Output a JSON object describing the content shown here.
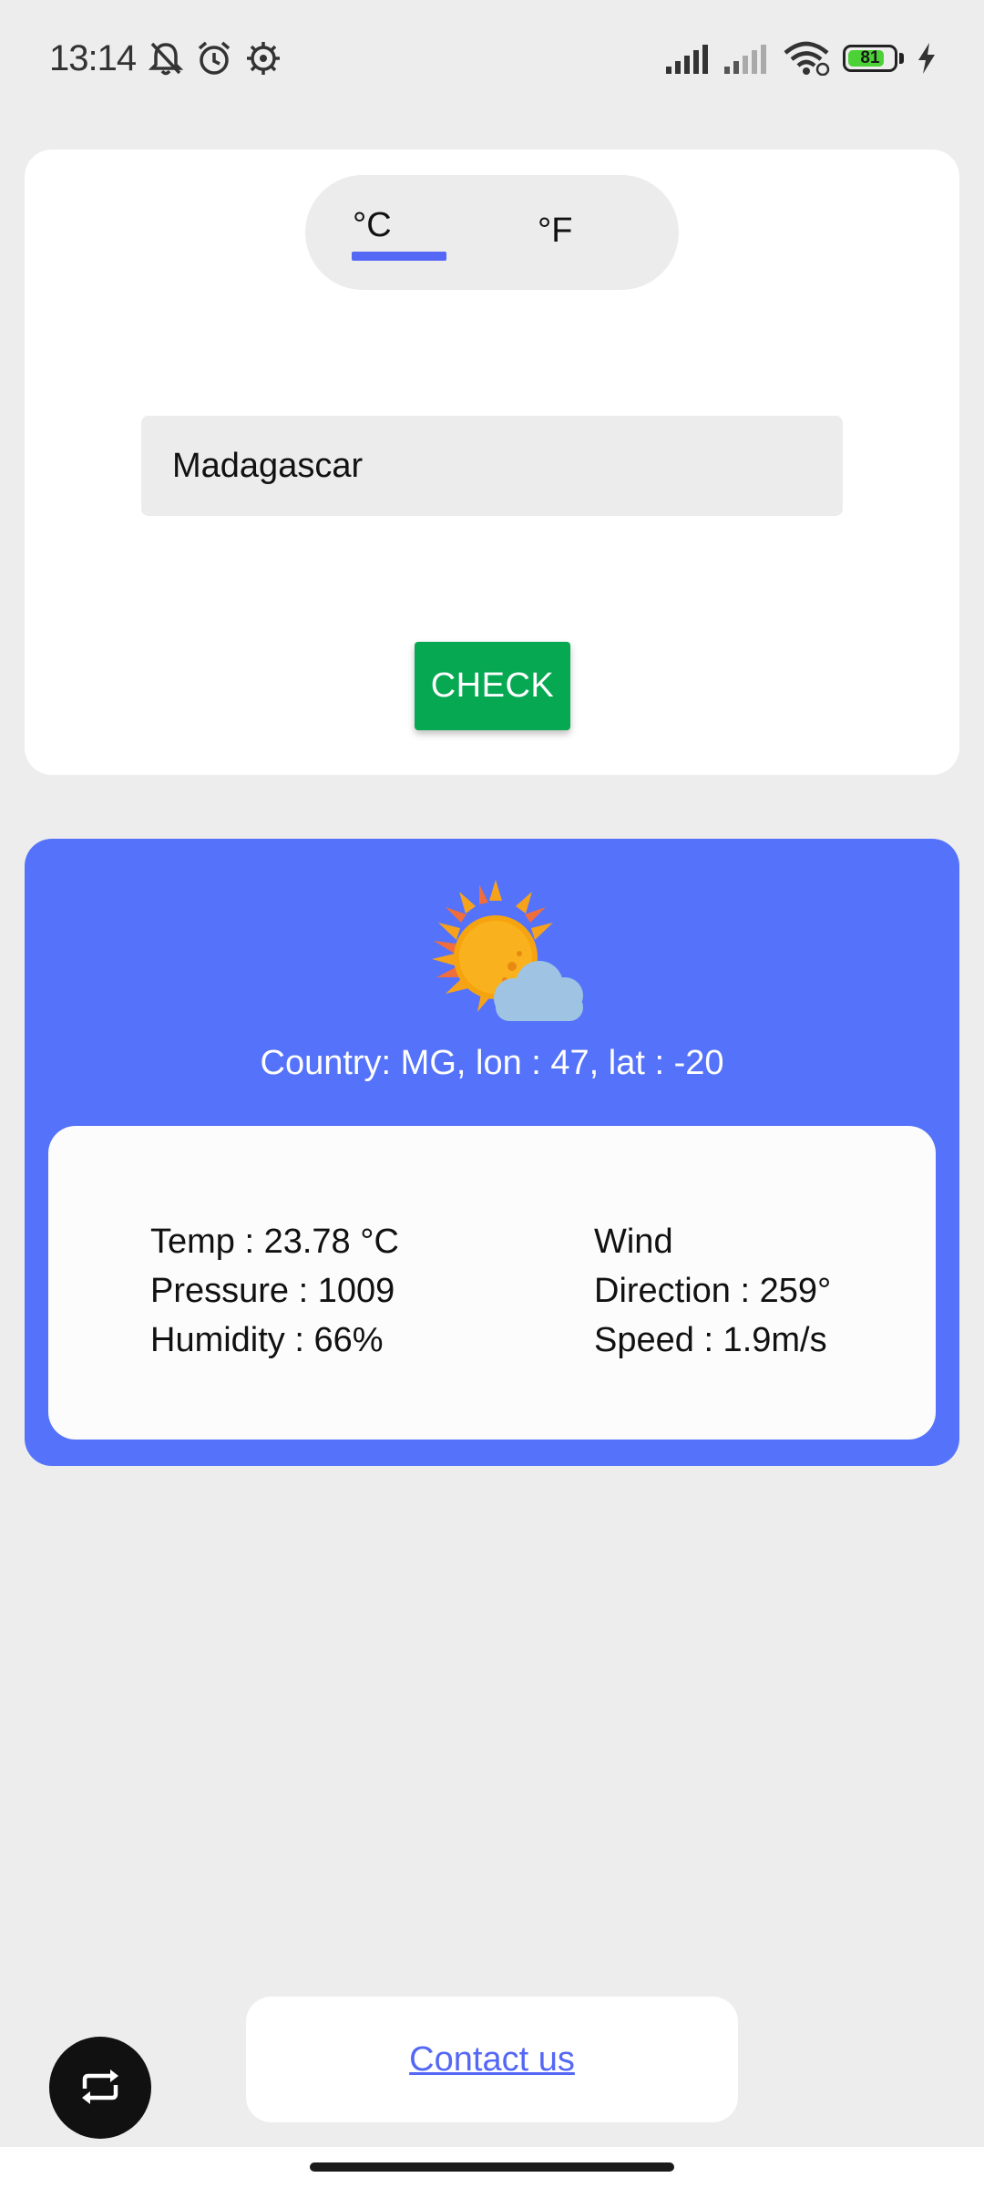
{
  "status_bar": {
    "time": "13:14",
    "battery_level": "81",
    "battery_fraction": 0.81,
    "icons": [
      "bell-muted-icon",
      "alarm-icon",
      "settings-gear-icon",
      "signal-full-icon",
      "signal-weak-icon",
      "wifi-icon",
      "battery-icon",
      "charging-bolt-icon"
    ]
  },
  "unit_toggle": {
    "celsius_label": "°C",
    "fahrenheit_label": "°F",
    "selected": "°C"
  },
  "search": {
    "value": "Madagascar"
  },
  "check_button": {
    "label": "CHECK"
  },
  "weather": {
    "icon": "sun-behind-cloud-icon",
    "location": "Country: MG, lon : 47, lat : -20",
    "temp": "Temp : 23.78 °C",
    "pressure": "Pressure : 1009",
    "humidity": "Humidity : 66%",
    "wind_title": "Wind",
    "direction": "Direction : 259°",
    "speed": "Speed : 1.9m/s"
  },
  "footer": {
    "contact_label": "Contact us",
    "refresh_icon": "repeat-icon"
  },
  "colors": {
    "accent_blue": "#5573fa",
    "link_blue": "#5468f5",
    "check_green": "#06a852",
    "background": "#ededed"
  }
}
